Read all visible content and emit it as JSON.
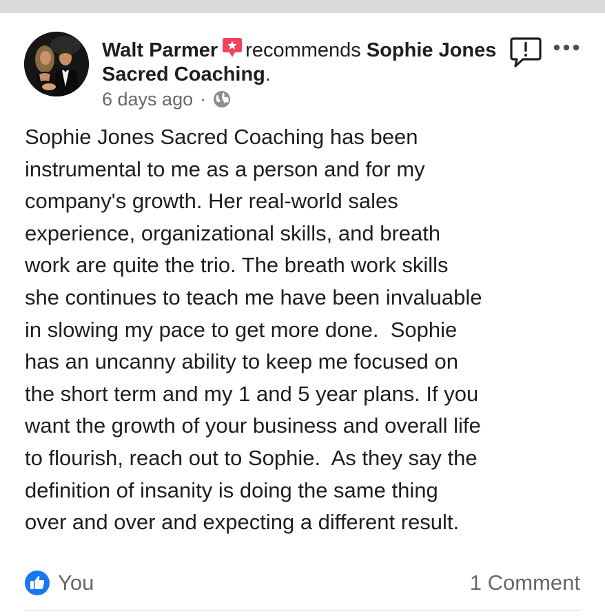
{
  "post": {
    "author": "Walt Parmer",
    "action": "recommends",
    "page_name": "Sophie Jones Sacred Coaching",
    "period": ".",
    "timestamp": "6 days ago",
    "separator": "·",
    "privacy_icon": "globe-icon",
    "recommend_icon": "recommend-star-icon",
    "body_lines": [
      "Sophie Jones Sacred Coaching has been",
      "instrumental to me as a person and for my",
      "company's growth. Her real-world sales",
      "experience, organizational skills, and breath",
      "work are quite the trio. The breath work skills",
      "she continues to teach me have been invaluable",
      "in slowing my pace to get more done.  Sophie",
      "has an uncanny ability to keep me focused on",
      "the short term and my 1 and 5 year plans. If you",
      "want the growth of your business and overall life",
      "to flourish, reach out to Sophie.  As they say the",
      "definition of insanity is doing the same thing",
      "over and over and expecting a different result."
    ]
  },
  "header_actions": {
    "report_icon": "report-icon",
    "more_icon": "more-options-icon"
  },
  "footer": {
    "like_icon": "like-thumb-icon",
    "reactor": "You",
    "comments": "1 Comment"
  },
  "colors": {
    "text": "#1c1e21",
    "secondary": "#65676b",
    "like_blue": "#1877f2",
    "recommend_red": "#f3425f",
    "top_band": "#d9dadc"
  }
}
